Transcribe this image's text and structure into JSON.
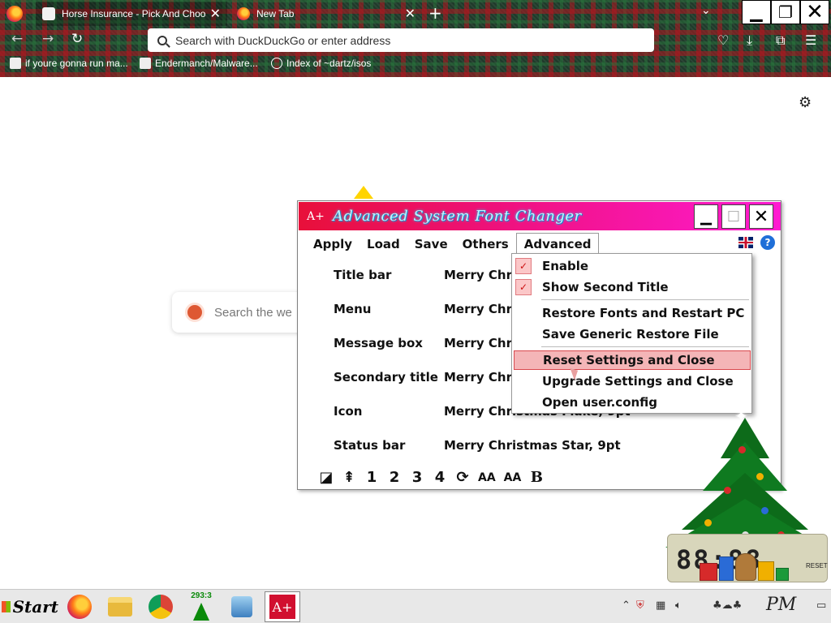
{
  "browser": {
    "tabs": [
      {
        "title": "Horse Insurance - Pick And Choos",
        "active": false
      },
      {
        "title": "New Tab",
        "active": true
      }
    ],
    "address_placeholder": "Search with DuckDuckGo or enter address",
    "bookmarks": [
      {
        "label": "if youre gonna run ma..."
      },
      {
        "label": "Endermanch/Malware..."
      },
      {
        "label": "Index of ~dartz/isos"
      }
    ]
  },
  "page": {
    "search_placeholder": "Search the we"
  },
  "font_changer": {
    "title": "Advanced System Font Changer",
    "app_icon": "A+",
    "menu": [
      "Apply",
      "Load",
      "Save",
      "Others",
      "Advanced"
    ],
    "rows": [
      {
        "label": "Title bar",
        "value": "Merry Chris"
      },
      {
        "label": "Menu",
        "value": "Merry Chris"
      },
      {
        "label": "Message box",
        "value": "Merry Chris"
      },
      {
        "label": "Secondary title",
        "value": "Merry Chris"
      },
      {
        "label": "Icon",
        "value": "Merry Christmas Flake, 9pt"
      },
      {
        "label": "Status bar",
        "value": "Merry Christmas Star, 9pt"
      }
    ],
    "toolbar": [
      "◪",
      "⇞",
      "1",
      "2",
      "3",
      "4",
      "⟳",
      "AA",
      "AA",
      "B"
    ],
    "help_label": "?"
  },
  "advanced_menu": {
    "items": [
      {
        "label": "Enable",
        "checked": true
      },
      {
        "label": "Show Second Title",
        "checked": true
      },
      {
        "label": "Restore Fonts and Restart PC",
        "checked": false
      },
      {
        "label": "Save Generic Restore File",
        "checked": false
      },
      {
        "label": "Reset Settings and Close",
        "checked": false,
        "highlighted": true
      },
      {
        "label": "Upgrade Settings and Close",
        "checked": false
      },
      {
        "label": "Open user.config",
        "checked": false
      }
    ]
  },
  "widget": {
    "reset_label": "RESET"
  },
  "taskbar": {
    "start_label": "Start",
    "tree_counter": "293:3",
    "tray_label": "PM"
  },
  "colors": {
    "title_gradient_start": "#e8103a",
    "title_gradient_end": "#ff1bd1",
    "highlight": "#f4b5b7",
    "highlight_border": "#d9484e",
    "tree_green": "#0d6b1a"
  }
}
